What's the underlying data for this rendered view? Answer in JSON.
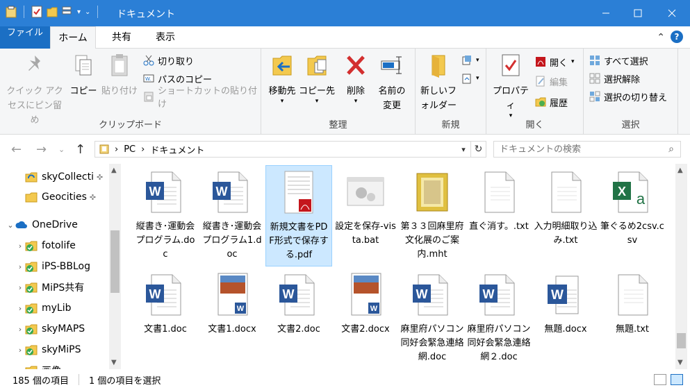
{
  "window": {
    "title": "ドキュメント"
  },
  "tabs": {
    "file": "ファイル",
    "home": "ホーム",
    "share": "共有",
    "view": "表示"
  },
  "ribbon": {
    "clipboard": {
      "label": "クリップボード",
      "pin": "クイック アクセスにピン留め",
      "copy": "コピー",
      "paste": "貼り付け",
      "cut": "切り取り",
      "copy_path": "パスのコピー",
      "paste_shortcut": "ショートカットの貼り付け"
    },
    "organize": {
      "label": "整理",
      "move_to": "移動先",
      "copy_to": "コピー先",
      "delete": "削除",
      "rename": "名前の変更"
    },
    "new": {
      "label": "新規",
      "new_folder": "新しいフォルダー"
    },
    "open": {
      "label": "開く",
      "properties": "プロパティ",
      "open": "開く",
      "edit": "編集",
      "history": "履歴"
    },
    "select": {
      "label": "選択",
      "select_all": "すべて選択",
      "select_none": "選択解除",
      "invert": "選択の切り替え"
    }
  },
  "address": {
    "crumbs": [
      "PC",
      "ドキュメント"
    ],
    "search_placeholder": "ドキュメントの検索"
  },
  "nav": [
    {
      "label": "skyCollecti",
      "icon": "sync-folder-icon",
      "pinned": true,
      "expander": "",
      "indent": 1
    },
    {
      "label": "Geocities",
      "icon": "folder-icon",
      "pinned": true,
      "expander": "",
      "indent": 1
    },
    {
      "label": "OneDrive",
      "icon": "cloud-icon",
      "pinned": false,
      "expander": "v",
      "indent": 0
    },
    {
      "label": "fotolife",
      "icon": "synced-folder-icon",
      "pinned": false,
      "expander": ">",
      "indent": 1
    },
    {
      "label": "iPS-BBLog",
      "icon": "synced-folder-icon",
      "pinned": false,
      "expander": ">",
      "indent": 1
    },
    {
      "label": "MiPS共有",
      "icon": "synced-folder-icon",
      "pinned": false,
      "expander": ">",
      "indent": 1
    },
    {
      "label": "myLib",
      "icon": "synced-folder-icon",
      "pinned": false,
      "expander": ">",
      "indent": 1
    },
    {
      "label": "skyMAPS",
      "icon": "synced-folder-icon",
      "pinned": false,
      "expander": ">",
      "indent": 1
    },
    {
      "label": "skyMiPS",
      "icon": "synced-folder-icon",
      "pinned": false,
      "expander": ">",
      "indent": 1
    },
    {
      "label": "画像",
      "icon": "synced-folder-icon",
      "pinned": false,
      "expander": ">",
      "indent": 1
    }
  ],
  "files": [
    {
      "name": "縦書き･運動会プログラム.doc",
      "type": "word",
      "selected": false
    },
    {
      "name": "縦書き･運動会プログラム1.doc",
      "type": "word",
      "selected": false
    },
    {
      "name": "新規文書をPDF形式で保存する.pdf",
      "type": "pdf",
      "selected": true
    },
    {
      "name": "設定を保存-vista.bat",
      "type": "bat",
      "selected": false
    },
    {
      "name": "第３３回麻里府文化展のご案内.mht",
      "type": "mht",
      "selected": false
    },
    {
      "name": "直ぐ消す。.txt",
      "type": "txt",
      "selected": false
    },
    {
      "name": "入力明細取り込み.txt",
      "type": "txt",
      "selected": false
    },
    {
      "name": "筆ぐるめ2csv.csv",
      "type": "csv",
      "selected": false
    },
    {
      "name": "文書1.doc",
      "type": "word",
      "selected": false
    },
    {
      "name": "文書1.docx",
      "type": "docx-thumb",
      "selected": false
    },
    {
      "name": "文書2.doc",
      "type": "word",
      "selected": false
    },
    {
      "name": "文書2.docx",
      "type": "docx-thumb",
      "selected": false
    },
    {
      "name": "麻里府パソコン同好会緊急連絡網.doc",
      "type": "word",
      "selected": false
    },
    {
      "name": "麻里府パソコン同好会緊急連絡網２.doc",
      "type": "word",
      "selected": false
    },
    {
      "name": "無題.docx",
      "type": "docx",
      "selected": false
    },
    {
      "name": "無題.txt",
      "type": "txt",
      "selected": false
    }
  ],
  "status": {
    "count": "185 個の項目",
    "selection": "1 個の項目を選択"
  },
  "colors": {
    "titlebar": "#2b7fd6",
    "file_tab": "#1b6fc4",
    "selection": "#cce8ff",
    "word": "#2b579a",
    "excel": "#217346",
    "pdf": "#c4161c"
  }
}
